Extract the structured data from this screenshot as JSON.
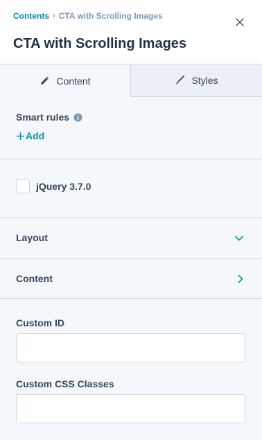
{
  "breadcrumb": {
    "parent": "Contents",
    "separator": "›",
    "current": "CTA with Scrolling Images"
  },
  "header": {
    "title": "CTA with Scrolling Images",
    "close_icon": "close-icon"
  },
  "tabs": [
    {
      "label": "Content",
      "icon": "pencil-icon",
      "active": true
    },
    {
      "label": "Styles",
      "icon": "brush-icon",
      "active": false
    }
  ],
  "smart_rules": {
    "title": "Smart rules",
    "info_icon": "info-icon",
    "add_label": "Add"
  },
  "checkbox": {
    "label": "jQuery 3.7.0",
    "checked": false
  },
  "sections": [
    {
      "label": "Layout",
      "icon": "chevron-down-icon"
    },
    {
      "label": "Content",
      "icon": "chevron-right-icon"
    }
  ],
  "fields": {
    "custom_id": {
      "label": "Custom ID",
      "value": "",
      "placeholder": ""
    },
    "custom_css": {
      "label": "Custom CSS Classes",
      "value": "",
      "placeholder": ""
    }
  },
  "colors": {
    "accent": "#0091ae",
    "text": "#33475b",
    "title": "#213343",
    "border": "#cbd6e2",
    "panel_bg": "#f5f8fa",
    "inactive_tab_bg": "#eaf0f6"
  }
}
